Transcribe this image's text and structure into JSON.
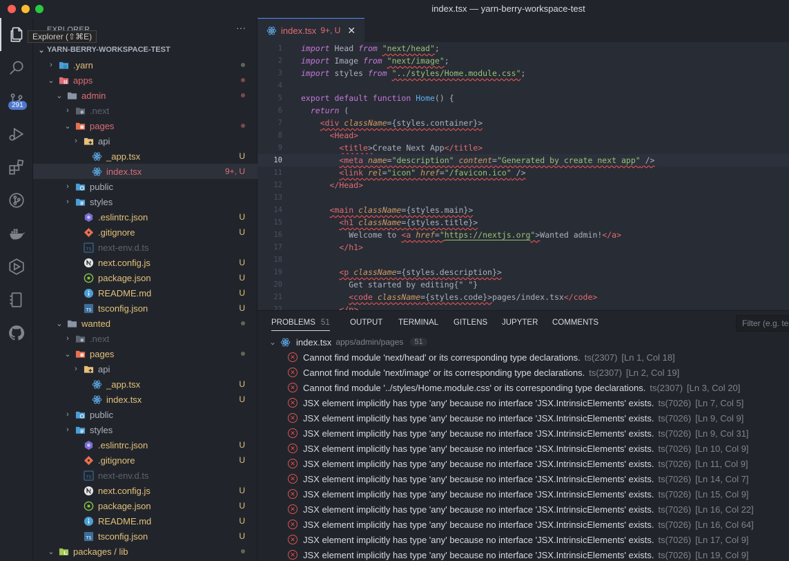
{
  "window": {
    "title": "index.tsx — yarn-berry-workspace-test"
  },
  "activity_bar": {
    "tooltip": "Explorer (⇧⌘E)",
    "source_control_badge": "291",
    "items": [
      "files-icon",
      "search-icon",
      "source-control-icon",
      "run-debug-icon",
      "extensions-icon",
      "git-graph-icon",
      "docker-icon",
      "live-share-icon",
      "remote-icon",
      "github-icon"
    ]
  },
  "explorer": {
    "header": "EXPLORER",
    "more": "···",
    "root": "YARN-BERRY-WORKSPACE-TEST",
    "tree": [
      {
        "label": ".yarn",
        "depth": 1,
        "type": "folder",
        "chev": "›",
        "icon": "yarn-folder-icon",
        "color": "git",
        "dot": "#5a6a57"
      },
      {
        "label": "apps",
        "depth": 1,
        "type": "folder",
        "chev": "⌄",
        "icon": "apps-folder-icon",
        "color": "red",
        "dot": "#7b4a4e"
      },
      {
        "label": "admin",
        "depth": 2,
        "type": "folder",
        "chev": "⌄",
        "icon": "folder-icon",
        "color": "red",
        "dot": "#7b4a4e"
      },
      {
        "label": ".next",
        "depth": 3,
        "type": "folder",
        "chev": "›",
        "icon": "next-folder-icon",
        "color": "dim"
      },
      {
        "label": "pages",
        "depth": 3,
        "type": "folder",
        "chev": "⌄",
        "icon": "pages-folder-icon",
        "color": "red",
        "dot": "#7b4a4e"
      },
      {
        "label": "api",
        "depth": 4,
        "type": "folder",
        "chev": "›",
        "icon": "api-folder-icon",
        "color": "norm"
      },
      {
        "label": "_app.tsx",
        "depth": 5,
        "type": "file",
        "icon": "react-icon",
        "color": "git",
        "status": "U"
      },
      {
        "label": "index.tsx",
        "depth": 5,
        "type": "file",
        "icon": "react-icon",
        "color": "red",
        "status": "9+, U",
        "selected": true
      },
      {
        "label": "public",
        "depth": 3,
        "type": "folder",
        "chev": "›",
        "icon": "public-folder-icon",
        "color": "norm"
      },
      {
        "label": "styles",
        "depth": 3,
        "type": "folder",
        "chev": "›",
        "icon": "styles-folder-icon",
        "color": "norm"
      },
      {
        "label": ".eslintrc.json",
        "depth": 4,
        "type": "file",
        "icon": "eslint-icon",
        "color": "git",
        "status": "U"
      },
      {
        "label": ".gitignore",
        "depth": 4,
        "type": "file",
        "icon": "git-icon",
        "color": "git",
        "status": "U"
      },
      {
        "label": "next-env.d.ts",
        "depth": 4,
        "type": "file",
        "icon": "ts-icon",
        "color": "dim"
      },
      {
        "label": "next.config.js",
        "depth": 4,
        "type": "file",
        "icon": "next-icon",
        "color": "git",
        "status": "U"
      },
      {
        "label": "package.json",
        "depth": 4,
        "type": "file",
        "icon": "npm-icon",
        "color": "git",
        "status": "U"
      },
      {
        "label": "README.md",
        "depth": 4,
        "type": "file",
        "icon": "info-icon",
        "color": "git",
        "status": "U"
      },
      {
        "label": "tsconfig.json",
        "depth": 4,
        "type": "file",
        "icon": "tsconfig-icon",
        "color": "git",
        "status": "U"
      },
      {
        "label": "wanted",
        "depth": 2,
        "type": "folder",
        "chev": "⌄",
        "icon": "folder-icon",
        "color": "git",
        "dot": "#5a6a57"
      },
      {
        "label": ".next",
        "depth": 3,
        "type": "folder",
        "chev": "›",
        "icon": "next-folder-icon",
        "color": "dim"
      },
      {
        "label": "pages",
        "depth": 3,
        "type": "folder",
        "chev": "⌄",
        "icon": "pages-folder-icon",
        "color": "git",
        "dot": "#5a6a57"
      },
      {
        "label": "api",
        "depth": 4,
        "type": "folder",
        "chev": "›",
        "icon": "api-folder-icon",
        "color": "norm"
      },
      {
        "label": "_app.tsx",
        "depth": 5,
        "type": "file",
        "icon": "react-icon",
        "color": "git",
        "status": "U"
      },
      {
        "label": "index.tsx",
        "depth": 5,
        "type": "file",
        "icon": "react-icon",
        "color": "git",
        "status": "U"
      },
      {
        "label": "public",
        "depth": 3,
        "type": "folder",
        "chev": "›",
        "icon": "public-folder-icon",
        "color": "norm"
      },
      {
        "label": "styles",
        "depth": 3,
        "type": "folder",
        "chev": "›",
        "icon": "styles-folder-icon",
        "color": "norm"
      },
      {
        "label": ".eslintrc.json",
        "depth": 4,
        "type": "file",
        "icon": "eslint-icon",
        "color": "git",
        "status": "U"
      },
      {
        "label": ".gitignore",
        "depth": 4,
        "type": "file",
        "icon": "git-icon",
        "color": "git",
        "status": "U"
      },
      {
        "label": "next-env.d.ts",
        "depth": 4,
        "type": "file",
        "icon": "ts-icon",
        "color": "dim"
      },
      {
        "label": "next.config.js",
        "depth": 4,
        "type": "file",
        "icon": "next-icon",
        "color": "git",
        "status": "U"
      },
      {
        "label": "package.json",
        "depth": 4,
        "type": "file",
        "icon": "npm-icon",
        "color": "git",
        "status": "U"
      },
      {
        "label": "README.md",
        "depth": 4,
        "type": "file",
        "icon": "info-icon",
        "color": "git",
        "status": "U"
      },
      {
        "label": "tsconfig.json",
        "depth": 4,
        "type": "file",
        "icon": "tsconfig-icon",
        "color": "git",
        "status": "U"
      },
      {
        "label": "packages / lib",
        "depth": 1,
        "type": "folder",
        "chev": "⌄",
        "icon": "lib-folder-icon",
        "color": "git",
        "dot": "#5a6a57"
      }
    ]
  },
  "editor": {
    "tab": {
      "name": "index.tsx",
      "status": "9+, U",
      "close": "✕"
    },
    "current_line": 10,
    "lines": [
      [
        [
          "k",
          "import"
        ],
        [
          "p",
          " Head "
        ],
        [
          "k",
          "from"
        ],
        [
          "p",
          " "
        ],
        [
          "s",
          "\"next/head\"",
          "sq"
        ],
        [
          "p",
          ";"
        ]
      ],
      [
        [
          "k",
          "import"
        ],
        [
          "p",
          " Image "
        ],
        [
          "k",
          "from"
        ],
        [
          "p",
          " "
        ],
        [
          "s",
          "\"next/image\"",
          "sq"
        ],
        [
          "p",
          ";"
        ]
      ],
      [
        [
          "k",
          "import"
        ],
        [
          "p",
          " styles "
        ],
        [
          "k",
          "from"
        ],
        [
          "p",
          " "
        ],
        [
          "s",
          "\"../styles/Home.module.css\"",
          "sq"
        ],
        [
          "p",
          ";"
        ]
      ],
      [],
      [
        [
          "kn",
          "export"
        ],
        [
          "p",
          " "
        ],
        [
          "kn",
          "default"
        ],
        [
          "p",
          " "
        ],
        [
          "kn",
          "function"
        ],
        [
          "p",
          " "
        ],
        [
          "f",
          "Home"
        ],
        [
          "p",
          "() {"
        ]
      ],
      [
        [
          "p",
          "  "
        ],
        [
          "k",
          "return"
        ],
        [
          "p",
          " ("
        ]
      ],
      [
        [
          "p",
          "    "
        ],
        [
          "t",
          "<div",
          "sq"
        ],
        [
          "p",
          " ",
          "sq"
        ],
        [
          "a",
          "className",
          "sq"
        ],
        [
          "p",
          "={styles.container}>",
          "sq"
        ]
      ],
      [
        [
          "p",
          "      "
        ],
        [
          "t",
          "<Head>"
        ]
      ],
      [
        [
          "p",
          "        "
        ],
        [
          "t",
          "<title",
          "sq"
        ],
        [
          "p",
          ">",
          "sq"
        ],
        [
          "p",
          "Create Next App"
        ],
        [
          "t",
          "</title>"
        ]
      ],
      [
        [
          "p",
          "        "
        ],
        [
          "t",
          "<meta",
          "sq"
        ],
        [
          "p",
          " ",
          "sq"
        ],
        [
          "a",
          "name",
          "sq"
        ],
        [
          "p",
          "=",
          "sq"
        ],
        [
          "s",
          "\"description\"",
          "sq"
        ],
        [
          "p",
          " ",
          "sq"
        ],
        [
          "a",
          "content",
          "sq"
        ],
        [
          "p",
          "=",
          "sq"
        ],
        [
          "s",
          "\"Generated by create next app\"",
          "sq"
        ],
        [
          "p",
          " />",
          "sq"
        ]
      ],
      [
        [
          "p",
          "        "
        ],
        [
          "t",
          "<link",
          "sq"
        ],
        [
          "p",
          " ",
          "sq"
        ],
        [
          "a",
          "rel",
          "sq"
        ],
        [
          "p",
          "=",
          "sq"
        ],
        [
          "s",
          "\"icon\"",
          "sq"
        ],
        [
          "p",
          " ",
          "sq"
        ],
        [
          "a",
          "href",
          "sq"
        ],
        [
          "p",
          "=",
          "sq"
        ],
        [
          "s",
          "\"/favicon.ico\"",
          "sq"
        ],
        [
          "p",
          " />",
          "sq"
        ]
      ],
      [
        [
          "p",
          "      "
        ],
        [
          "t",
          "</Head>"
        ]
      ],
      [],
      [
        [
          "p",
          "      "
        ],
        [
          "t",
          "<main",
          "sq"
        ],
        [
          "p",
          " ",
          "sq"
        ],
        [
          "a",
          "className",
          "sq"
        ],
        [
          "p",
          "={styles.main}>",
          "sq"
        ]
      ],
      [
        [
          "p",
          "        "
        ],
        [
          "t",
          "<h1",
          "sq"
        ],
        [
          "p",
          " ",
          "sq"
        ],
        [
          "a",
          "className",
          "sq"
        ],
        [
          "p",
          "={styles.title}>",
          "sq"
        ]
      ],
      [
        [
          "p",
          "          Welcome to "
        ],
        [
          "t",
          "<a",
          "sq"
        ],
        [
          "p",
          " ",
          "sq"
        ],
        [
          "a",
          "href",
          "sq"
        ],
        [
          "p",
          "=",
          "sq"
        ],
        [
          "s",
          "\"",
          "sq"
        ],
        [
          "s",
          "https://nextjs.org",
          "link"
        ],
        [
          "s",
          "\"",
          "sq"
        ],
        [
          "p",
          ">",
          "sq"
        ],
        [
          "p",
          "Wanted admin!"
        ],
        [
          "t",
          "</a>"
        ]
      ],
      [
        [
          "p",
          "        "
        ],
        [
          "t",
          "</h1>"
        ]
      ],
      [],
      [
        [
          "p",
          "        "
        ],
        [
          "t",
          "<p",
          "sq"
        ],
        [
          "p",
          " ",
          "sq"
        ],
        [
          "a",
          "className",
          "sq"
        ],
        [
          "p",
          "={styles.description}>",
          "sq"
        ]
      ],
      [
        [
          "p",
          "          Get started by editing{\" \"}"
        ]
      ],
      [
        [
          "p",
          "          "
        ],
        [
          "t",
          "<code",
          "sq"
        ],
        [
          "p",
          " ",
          "sq"
        ],
        [
          "a",
          "className",
          "sq"
        ],
        [
          "p",
          "={styles.code}>",
          "sq"
        ],
        [
          "p",
          "pages/index.tsx"
        ],
        [
          "t",
          "</code>"
        ]
      ],
      [
        [
          "p",
          "        "
        ],
        [
          "t",
          "</p>"
        ]
      ]
    ]
  },
  "panel": {
    "tabs": [
      {
        "label": "PROBLEMS",
        "count": "51",
        "active": true
      },
      {
        "label": "OUTPUT"
      },
      {
        "label": "TERMINAL"
      },
      {
        "label": "GITLENS"
      },
      {
        "label": "JUPYTER"
      },
      {
        "label": "COMMENTS"
      }
    ],
    "filter_placeholder": "Filter (e.g. text",
    "file": {
      "name": "index.tsx",
      "path": "apps/admin/pages",
      "count": "51"
    },
    "problems": [
      {
        "msg": "Cannot find module 'next/head' or its corresponding type declarations.",
        "code": "ts(2307)",
        "loc": "[Ln 1, Col 18]"
      },
      {
        "msg": "Cannot find module 'next/image' or its corresponding type declarations.",
        "code": "ts(2307)",
        "loc": "[Ln 2, Col 19]"
      },
      {
        "msg": "Cannot find module '../styles/Home.module.css' or its corresponding type declarations.",
        "code": "ts(2307)",
        "loc": "[Ln 3, Col 20]"
      },
      {
        "msg": "JSX element implicitly has type 'any' because no interface 'JSX.IntrinsicElements' exists.",
        "code": "ts(7026)",
        "loc": "[Ln 7, Col 5]"
      },
      {
        "msg": "JSX element implicitly has type 'any' because no interface 'JSX.IntrinsicElements' exists.",
        "code": "ts(7026)",
        "loc": "[Ln 9, Col 9]"
      },
      {
        "msg": "JSX element implicitly has type 'any' because no interface 'JSX.IntrinsicElements' exists.",
        "code": "ts(7026)",
        "loc": "[Ln 9, Col 31]"
      },
      {
        "msg": "JSX element implicitly has type 'any' because no interface 'JSX.IntrinsicElements' exists.",
        "code": "ts(7026)",
        "loc": "[Ln 10, Col 9]"
      },
      {
        "msg": "JSX element implicitly has type 'any' because no interface 'JSX.IntrinsicElements' exists.",
        "code": "ts(7026)",
        "loc": "[Ln 11, Col 9]"
      },
      {
        "msg": "JSX element implicitly has type 'any' because no interface 'JSX.IntrinsicElements' exists.",
        "code": "ts(7026)",
        "loc": "[Ln 14, Col 7]"
      },
      {
        "msg": "JSX element implicitly has type 'any' because no interface 'JSX.IntrinsicElements' exists.",
        "code": "ts(7026)",
        "loc": "[Ln 15, Col 9]"
      },
      {
        "msg": "JSX element implicitly has type 'any' because no interface 'JSX.IntrinsicElements' exists.",
        "code": "ts(7026)",
        "loc": "[Ln 16, Col 22]"
      },
      {
        "msg": "JSX element implicitly has type 'any' because no interface 'JSX.IntrinsicElements' exists.",
        "code": "ts(7026)",
        "loc": "[Ln 16, Col 64]"
      },
      {
        "msg": "JSX element implicitly has type 'any' because no interface 'JSX.IntrinsicElements' exists.",
        "code": "ts(7026)",
        "loc": "[Ln 17, Col 9]"
      },
      {
        "msg": "JSX element implicitly has type 'any' because no interface 'JSX.IntrinsicElements' exists.",
        "code": "ts(7026)",
        "loc": "[Ln 19, Col 9]"
      }
    ]
  },
  "colors": {
    "accent": "#528bff",
    "error": "#e05252",
    "git_untracked": "#e5c07b",
    "git_modified": "#e06c75"
  }
}
